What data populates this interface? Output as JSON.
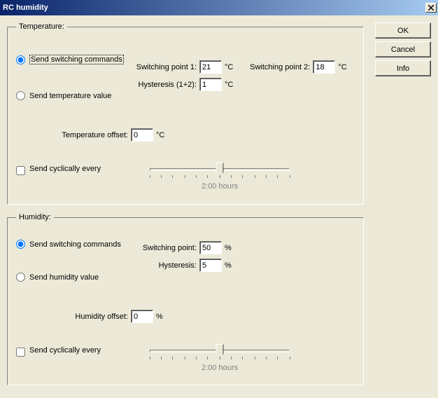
{
  "window": {
    "title": "RC humidity"
  },
  "buttons": {
    "ok": "OK",
    "cancel": "Cancel",
    "info": "Info"
  },
  "temperature": {
    "legend": "Temperature:",
    "radio_switching": "Send switching commands",
    "radio_value": "Send temperature value",
    "sp1_label": "Switching point 1:",
    "sp1_value": "21",
    "sp1_unit": "°C",
    "sp2_label": "Switching point 2:",
    "sp2_value": "18",
    "sp2_unit": "°C",
    "hyst_label": "Hysteresis (1+2):",
    "hyst_value": "1",
    "hyst_unit": "°C",
    "offset_label": "Temperature offset:",
    "offset_value": "0",
    "offset_unit": "°C",
    "cyclic_label": "Send cyclically every",
    "cyclic_caption": "2:00 hours"
  },
  "humidity": {
    "legend": "Humidity:",
    "radio_switching": "Send switching commands",
    "radio_value": "Send humidity value",
    "sp_label": "Switching point:",
    "sp_value": "50",
    "sp_unit": "%",
    "hyst_label": "Hysteresis:",
    "hyst_value": "5",
    "hyst_unit": "%",
    "offset_label": "Humidity offset:",
    "offset_value": "0",
    "offset_unit": "%",
    "cyclic_label": "Send cyclically every",
    "cyclic_caption": "2:00 hours"
  }
}
